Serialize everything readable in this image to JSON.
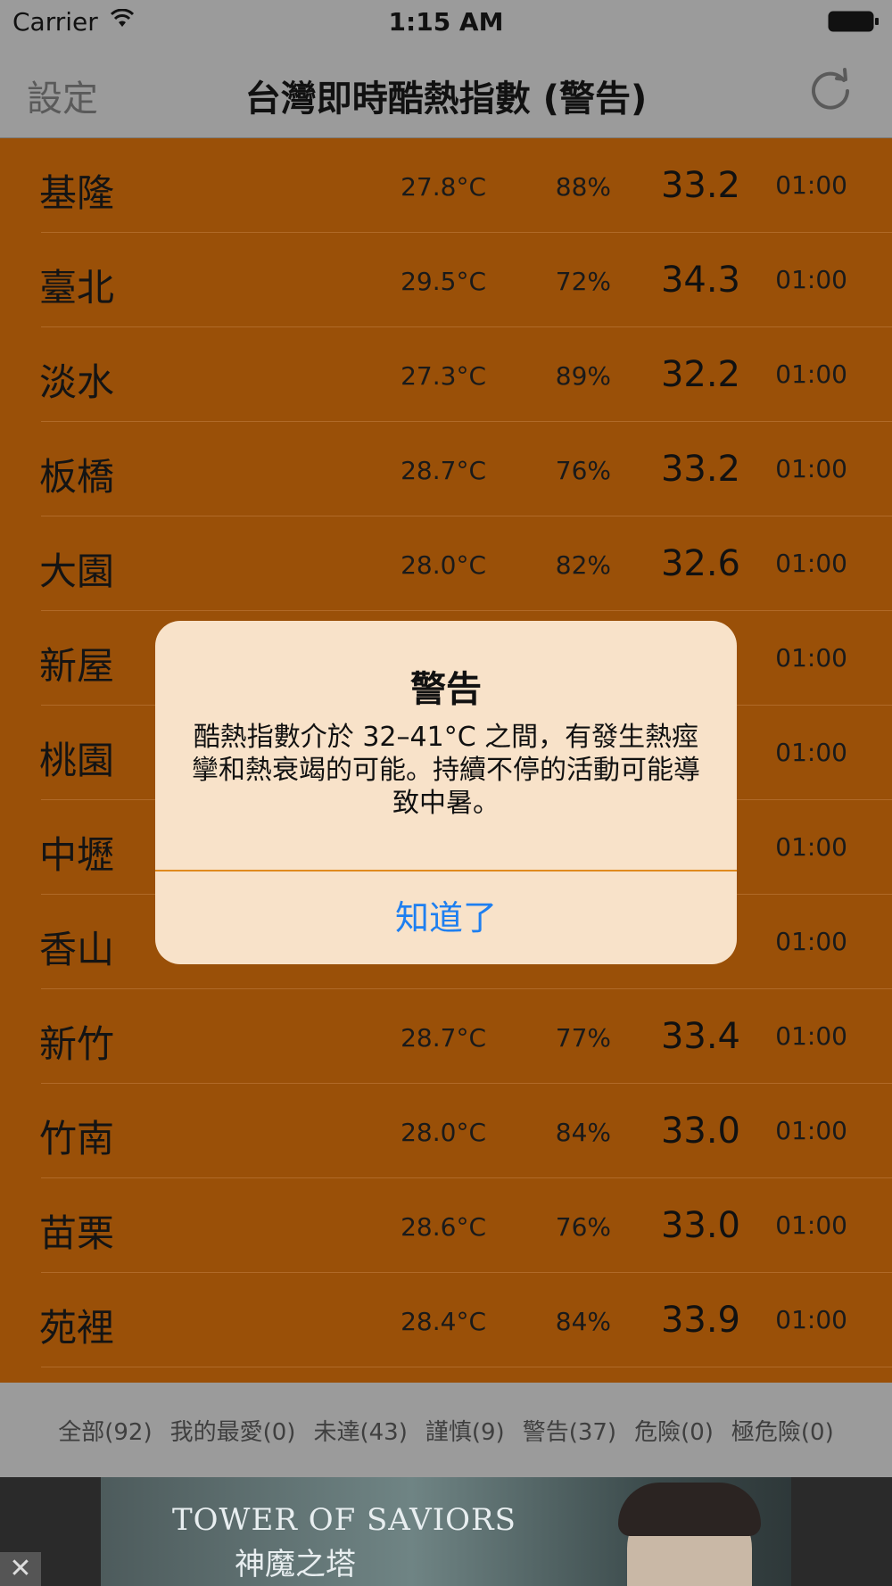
{
  "status_bar": {
    "carrier": "Carrier",
    "time": "1:15 AM"
  },
  "nav": {
    "left_button": "設定",
    "title": "台灣即時酷熱指數 (警告)",
    "right_icon": "refresh-icon"
  },
  "rows": [
    {
      "name": "基隆",
      "temp": "27.8°C",
      "humidity": "88%",
      "index": "33.2",
      "time": "01:00"
    },
    {
      "name": "臺北",
      "temp": "29.5°C",
      "humidity": "72%",
      "index": "34.3",
      "time": "01:00"
    },
    {
      "name": "淡水",
      "temp": "27.3°C",
      "humidity": "89%",
      "index": "32.2",
      "time": "01:00"
    },
    {
      "name": "板橋",
      "temp": "28.7°C",
      "humidity": "76%",
      "index": "33.2",
      "time": "01:00"
    },
    {
      "name": "大園",
      "temp": "28.0°C",
      "humidity": "82%",
      "index": "32.6",
      "time": "01:00"
    },
    {
      "name": "新屋",
      "temp": "",
      "humidity": "",
      "index": "",
      "time": "01:00"
    },
    {
      "name": "桃園",
      "temp": "",
      "humidity": "",
      "index": "",
      "time": "01:00"
    },
    {
      "name": "中壢",
      "temp": "",
      "humidity": "",
      "index": "",
      "time": "01:00"
    },
    {
      "name": "香山",
      "temp": "",
      "humidity": "",
      "index": "",
      "time": "01:00"
    },
    {
      "name": "新竹",
      "temp": "28.7°C",
      "humidity": "77%",
      "index": "33.4",
      "time": "01:00"
    },
    {
      "name": "竹南",
      "temp": "28.0°C",
      "humidity": "84%",
      "index": "33.0",
      "time": "01:00"
    },
    {
      "name": "苗栗",
      "temp": "28.6°C",
      "humidity": "76%",
      "index": "33.0",
      "time": "01:00"
    },
    {
      "name": "苑裡",
      "temp": "28.4°C",
      "humidity": "84%",
      "index": "33.9",
      "time": "01:00"
    }
  ],
  "filters": [
    "全部(92)",
    "我的最愛(0)",
    "未達(43)",
    "謹慎(9)",
    "警告(37)",
    "危險(0)",
    "極危險(0)"
  ],
  "ad": {
    "line1": "TOWER OF SAVIORS",
    "line2": "神魔之塔",
    "close": "✕"
  },
  "alert": {
    "title": "警告",
    "message": "酷熱指數介於 32–41°C 之間，有發生熱痙攣和熱衰竭的可能。持續不停的活動可能導致中暑。",
    "button": "知道了"
  },
  "colors": {
    "row_bg": "#9a5008",
    "alert_bg": "#f8e2c9",
    "alert_button": "#1e7ff0",
    "bars": "#9b9b9b"
  }
}
